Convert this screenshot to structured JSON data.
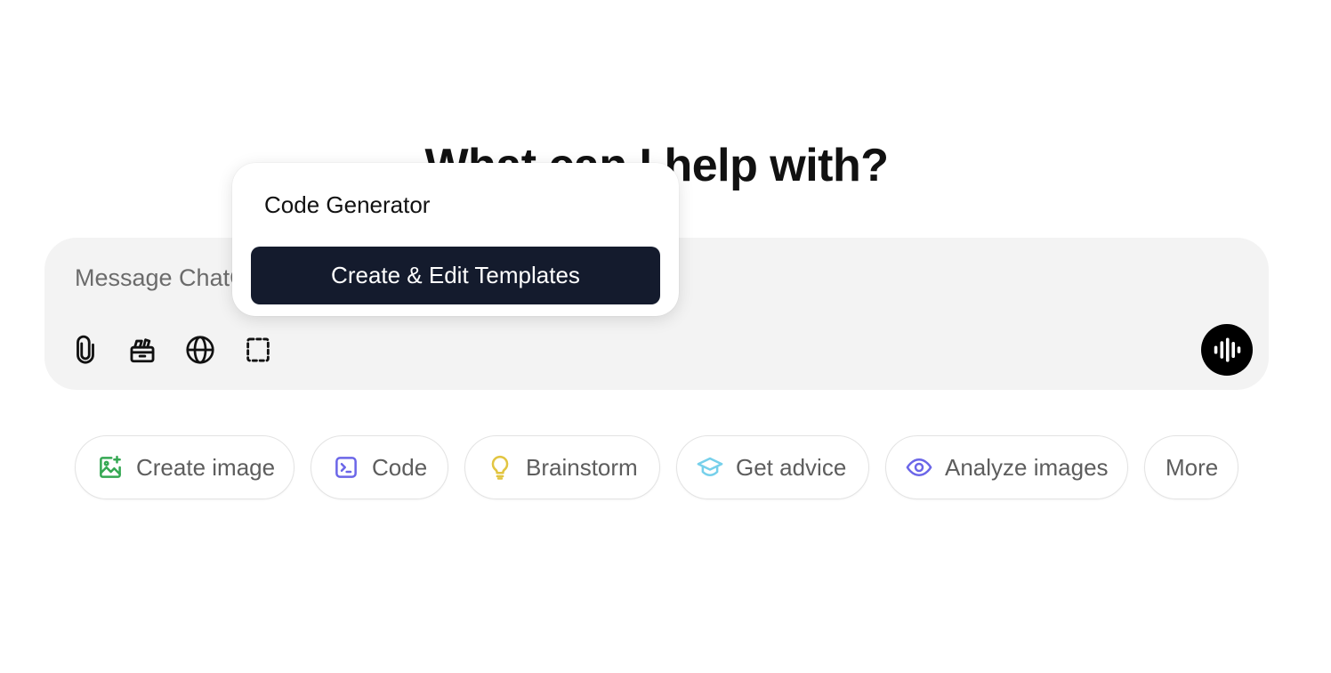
{
  "heading": "What can I help with?",
  "composer": {
    "placeholder": "Message ChatGPT",
    "tools": [
      {
        "icon": "paperclip-icon"
      },
      {
        "icon": "templates-box-icon"
      },
      {
        "icon": "globe-icon"
      },
      {
        "icon": "select-region-icon"
      }
    ],
    "voice_icon": "voice-waveform-icon"
  },
  "popup": {
    "item": "Code Generator",
    "button": "Create & Edit Templates"
  },
  "chips": [
    {
      "label": "Create image",
      "icon": "image-sparkle-icon",
      "color": "#35a853"
    },
    {
      "label": "Code",
      "icon": "terminal-icon",
      "color": "#6b66e8"
    },
    {
      "label": "Brainstorm",
      "icon": "lightbulb-icon",
      "color": "#e2c541"
    },
    {
      "label": "Get advice",
      "icon": "graduation-cap-icon",
      "color": "#76d0eb"
    },
    {
      "label": "Analyze images",
      "icon": "eye-icon",
      "color": "#6b66e8"
    },
    {
      "label": "More",
      "icon": "",
      "color": ""
    }
  ]
}
